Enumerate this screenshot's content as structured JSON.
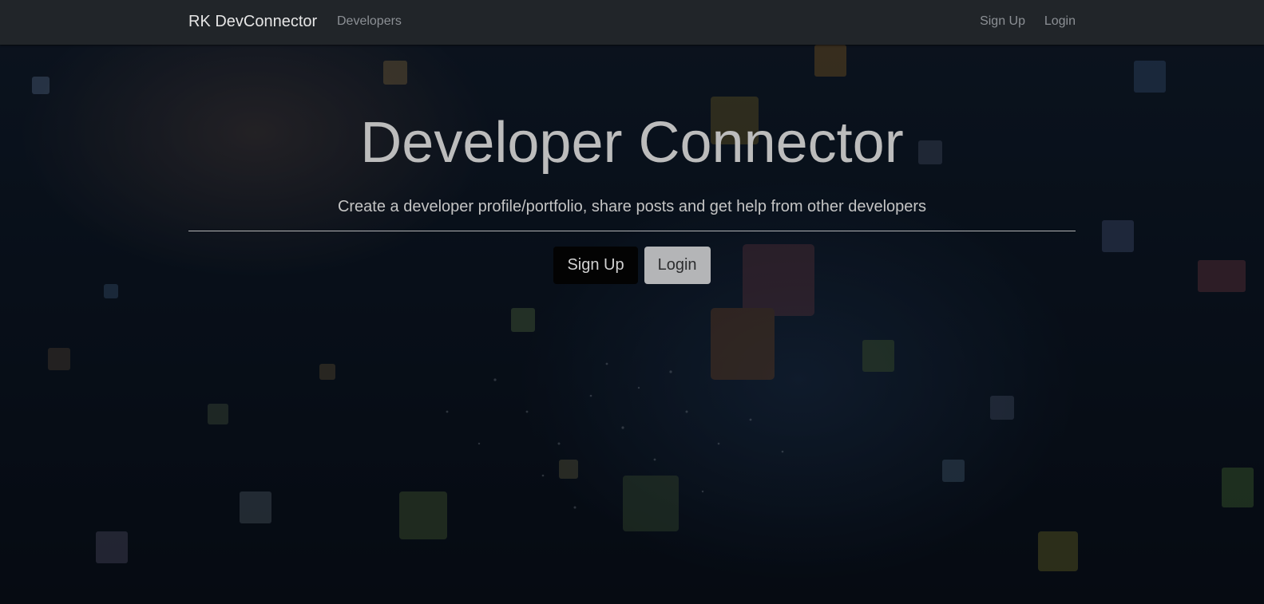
{
  "navbar": {
    "brand": "RK DevConnector",
    "developers_link": "Developers",
    "signup_link": "Sign Up",
    "login_link": "Login"
  },
  "hero": {
    "title": "Developer Connector",
    "lead": "Create a developer profile/portfolio, share posts and get help from other developers",
    "signup_button": "Sign Up",
    "login_button": "Login"
  },
  "colors": {
    "navbar_bg": "#212529",
    "signup_button_bg": "#030303",
    "login_button_bg": "#b4b5b7",
    "title_text": "#bcbcbc"
  }
}
